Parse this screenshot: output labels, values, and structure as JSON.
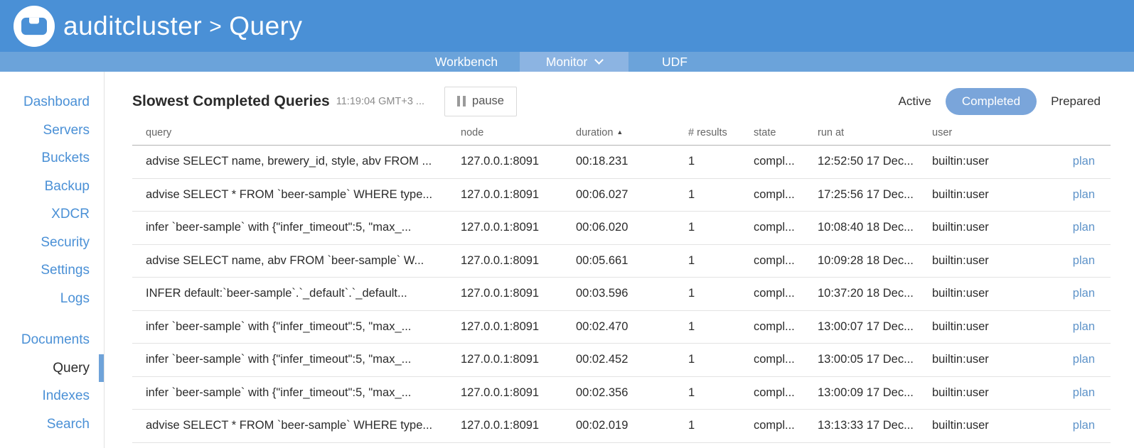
{
  "header": {
    "cluster_name": "auditcluster",
    "separator": ">",
    "section": "Query"
  },
  "tabs": [
    {
      "label": "Workbench"
    },
    {
      "label": "Monitor"
    },
    {
      "label": "UDF"
    }
  ],
  "sidebar": {
    "items": [
      {
        "label": "Dashboard"
      },
      {
        "label": "Servers"
      },
      {
        "label": "Buckets"
      },
      {
        "label": "Backup"
      },
      {
        "label": "XDCR"
      },
      {
        "label": "Security"
      },
      {
        "label": "Settings"
      },
      {
        "label": "Logs"
      },
      {
        "label": "Documents"
      },
      {
        "label": "Query"
      },
      {
        "label": "Indexes"
      },
      {
        "label": "Search"
      }
    ],
    "selected": "Query"
  },
  "content": {
    "title": "Slowest Completed Queries",
    "timestamp": "11:19:04 GMT+3 ...",
    "pause_label": "pause",
    "filters": {
      "active": "Active",
      "completed": "Completed",
      "prepared": "Prepared"
    },
    "selected_filter": "Completed"
  },
  "table": {
    "columns": [
      "query",
      "node",
      "duration",
      "# results",
      "state",
      "run at",
      "user"
    ],
    "sort_column": "duration",
    "sort_direction": "ascending",
    "rows": [
      {
        "query": "advise SELECT name, brewery_id, style, abv FROM ...",
        "node": "127.0.0.1:8091",
        "duration": "00:18.231",
        "results": "1",
        "state": "compl...",
        "run_at": "12:52:50 17 Dec...",
        "user": "builtin:user",
        "plan_label": "plan"
      },
      {
        "query": "advise SELECT * FROM `beer-sample` WHERE type...",
        "node": "127.0.0.1:8091",
        "duration": "00:06.027",
        "results": "1",
        "state": "compl...",
        "run_at": "17:25:56 17 Dec...",
        "user": "builtin:user",
        "plan_label": "plan"
      },
      {
        "query": "infer `beer-sample` with {\"infer_timeout\":5, \"max_...",
        "node": "127.0.0.1:8091",
        "duration": "00:06.020",
        "results": "1",
        "state": "compl...",
        "run_at": "10:08:40 18 Dec...",
        "user": "builtin:user",
        "plan_label": "plan"
      },
      {
        "query": "advise SELECT name, abv FROM `beer-sample` W...",
        "node": "127.0.0.1:8091",
        "duration": "00:05.661",
        "results": "1",
        "state": "compl...",
        "run_at": "10:09:28 18 Dec...",
        "user": "builtin:user",
        "plan_label": "plan"
      },
      {
        "query": "INFER default:`beer-sample`.`_default`.`_default...",
        "node": "127.0.0.1:8091",
        "duration": "00:03.596",
        "results": "1",
        "state": "compl...",
        "run_at": "10:37:20 18 Dec...",
        "user": "builtin:user",
        "plan_label": "plan"
      },
      {
        "query": "infer `beer-sample` with {\"infer_timeout\":5, \"max_...",
        "node": "127.0.0.1:8091",
        "duration": "00:02.470",
        "results": "1",
        "state": "compl...",
        "run_at": "13:00:07 17 Dec...",
        "user": "builtin:user",
        "plan_label": "plan"
      },
      {
        "query": "infer `beer-sample` with {\"infer_timeout\":5, \"max_...",
        "node": "127.0.0.1:8091",
        "duration": "00:02.452",
        "results": "1",
        "state": "compl...",
        "run_at": "13:00:05 17 Dec...",
        "user": "builtin:user",
        "plan_label": "plan"
      },
      {
        "query": "infer `beer-sample` with {\"infer_timeout\":5, \"max_...",
        "node": "127.0.0.1:8091",
        "duration": "00:02.356",
        "results": "1",
        "state": "compl...",
        "run_at": "13:00:09 17 Dec...",
        "user": "builtin:user",
        "plan_label": "plan"
      },
      {
        "query": "advise SELECT * FROM `beer-sample` WHERE type...",
        "node": "127.0.0.1:8091",
        "duration": "00:02.019",
        "results": "1",
        "state": "compl...",
        "run_at": "13:13:33 17 Dec...",
        "user": "builtin:user",
        "plan_label": "plan"
      }
    ]
  },
  "colors": {
    "topbar": "#4a90d6",
    "tabstrip": "#6ba3da",
    "tab_active": "#8cb4e2",
    "sidebar_link": "#4a90d6",
    "selected_marker": "#6fa3d9",
    "completed_pill": "#7aa5da",
    "plan_link": "#5e93c9"
  }
}
